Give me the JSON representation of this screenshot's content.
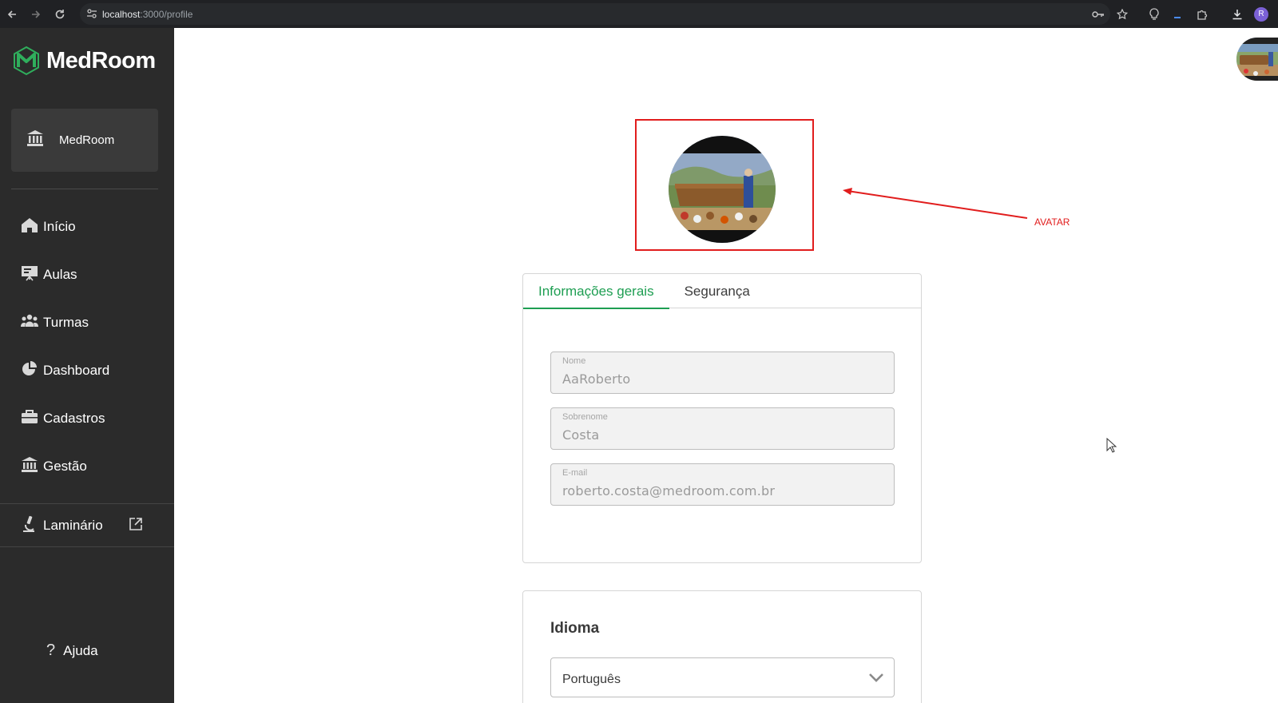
{
  "browser": {
    "url_host": "localhost",
    "url_path": ":3000/profile",
    "profile_initial": "R"
  },
  "sidebar": {
    "brand": "MedRoom",
    "organization": "MedRoom",
    "items": [
      {
        "label": "Início",
        "icon": "home-icon"
      },
      {
        "label": "Aulas",
        "icon": "presentation-icon"
      },
      {
        "label": "Turmas",
        "icon": "users-icon"
      },
      {
        "label": "Dashboard",
        "icon": "pie-chart-icon"
      },
      {
        "label": "Cadastros",
        "icon": "briefcase-icon"
      },
      {
        "label": "Gestão",
        "icon": "institution-icon"
      }
    ],
    "external_item": {
      "label": "Laminário",
      "icon": "microscope-icon"
    },
    "help_label": "Ajuda"
  },
  "annotation": {
    "label": "AVATAR",
    "color": "#e11d1d"
  },
  "profile": {
    "tabs": [
      {
        "label": "Informações gerais",
        "active": true
      },
      {
        "label": "Segurança",
        "active": false
      }
    ],
    "fields": [
      {
        "label": "Nome",
        "value": "AaRoberto"
      },
      {
        "label": "Sobrenome",
        "value": "Costa"
      },
      {
        "label": "E-mail",
        "value": "roberto.costa@medroom.com.br"
      }
    ]
  },
  "language": {
    "title": "Idioma",
    "selected": "Português"
  },
  "colors": {
    "accent": "#1e9e52",
    "sidebar_bg": "#2b2b2b"
  }
}
